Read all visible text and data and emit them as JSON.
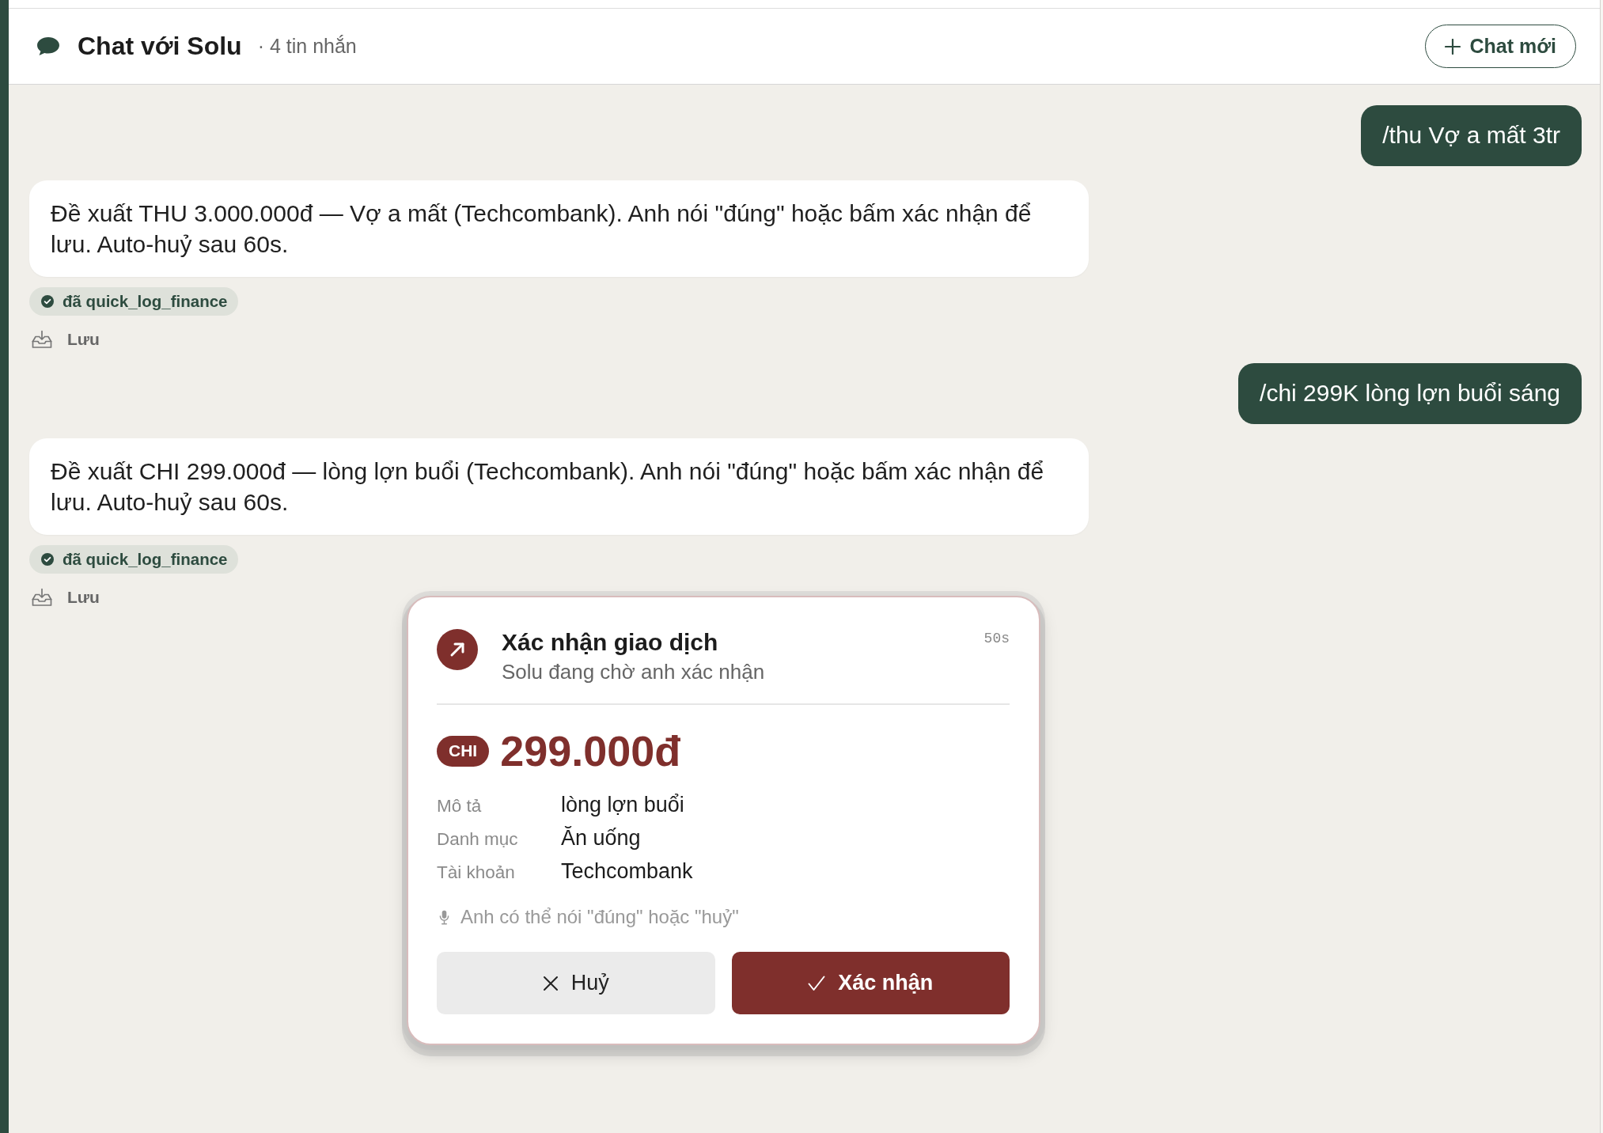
{
  "header": {
    "title": "Chat với Solu",
    "message_count": "· 4 tin nhắn",
    "new_chat_button": {
      "label": "Chat mới"
    }
  },
  "messages": [
    {
      "kind": "user",
      "text": "/thu Vợ a mất 3tr"
    },
    {
      "kind": "assistant",
      "text": "Đề xuất THU 3.000.000đ — Vợ a mất (Techcombank). Anh nói \"đúng\" hoặc bấm xác nhận để lưu. Auto-huỷ sau 60s.",
      "tool_chip": "đã quick_log_finance",
      "save_label": "Lưu"
    },
    {
      "kind": "user",
      "text": "/chi 299K lòng lợn buổi sáng"
    },
    {
      "kind": "assistant",
      "text": "Đề xuất CHI 299.000đ — lòng lợn buổi (Techcombank). Anh nói \"đúng\" hoặc bấm xác nhận để lưu. Auto-huỷ sau 60s.",
      "tool_chip": "đã quick_log_finance",
      "save_label": "Lưu"
    }
  ],
  "confirm_dialog": {
    "title": "Xác nhận giao dịch",
    "subtitle": "Solu đang chờ anh xác nhận",
    "countdown": "50s",
    "type_badge": "CHI",
    "amount": "299.000đ",
    "details": [
      {
        "label": "Mô tả",
        "value": "lòng lợn buổi"
      },
      {
        "label": "Danh mục",
        "value": "Ăn uống"
      },
      {
        "label": "Tài khoản",
        "value": "Techcombank"
      }
    ],
    "voice_hint": "Anh có thể nói \"đúng\" hoặc \"huỷ\"",
    "buttons": [
      {
        "kind": "cancel",
        "label": "Huỷ"
      },
      {
        "kind": "confirm",
        "label": "Xác nhận"
      }
    ]
  }
}
